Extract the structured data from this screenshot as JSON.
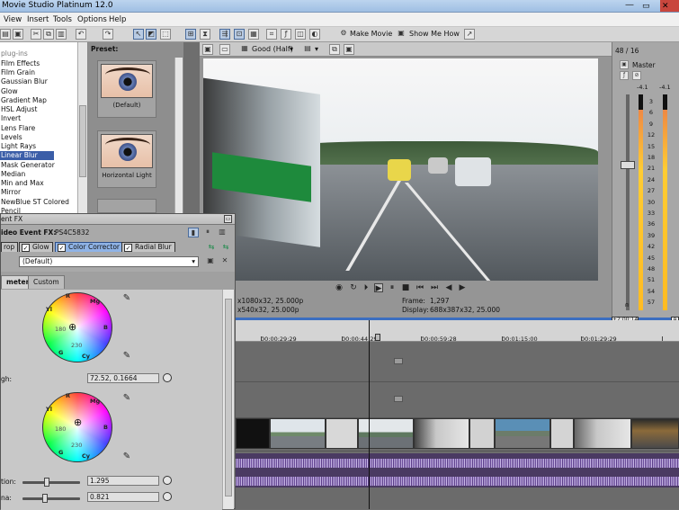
{
  "window": {
    "title": "Movie Studio Platinum 12.0",
    "minimize_glyph": "—"
  },
  "menu": {
    "items": [
      "View",
      "Insert",
      "Tools",
      "Options",
      "Help"
    ]
  },
  "toolbar": {
    "make_movie": "Make Movie",
    "show_me_how": "Show Me How"
  },
  "fx_browser": {
    "truncated_item": "plug-ins",
    "items": [
      "Film Effects",
      "Film Grain",
      "Gaussian Blur",
      "Glow",
      "Gradient Map",
      "HSL Adjust",
      "Invert",
      "Lens Flare",
      "Levels",
      "Light Rays",
      "Linear Blur",
      "Mask Generator",
      "Median",
      "Min and Max",
      "Mirror",
      "NewBlue ST Colored Pencil"
    ],
    "selected": "Linear Blur",
    "preset_label": "Preset:",
    "presets": [
      "(Default)",
      "Horizontal Light"
    ]
  },
  "preview": {
    "quality": "Good (Half)",
    "project": "x1080x32, 25.000p",
    "preview": "x540x32, 25.000p",
    "frame_label": "Frame:",
    "frame_value": "1,297",
    "display_label": "Display:",
    "display_value": "688x387x32, 25.000"
  },
  "mixer": {
    "rate": "48 / 16",
    "master": "Master",
    "peak_left": "-4.1",
    "peak_right": "-4.1",
    "scale": [
      "3",
      "6",
      "9",
      "12",
      "15",
      "18",
      "21",
      "24",
      "27",
      "30",
      "33",
      "36",
      "39",
      "42",
      "45",
      "48",
      "51",
      "54",
      "57"
    ],
    "levels": [
      0.93,
      0.93
    ]
  },
  "timeline": {
    "ruler": [
      "00:00:29:29",
      "00:00:44:29",
      "00:00:59:28",
      "00:01:15:00",
      "00:01:29:29"
    ],
    "cursor_time": "+2:00:14",
    "marker": "P"
  },
  "event_fx": {
    "window_title": "ent FX",
    "heading": "ideo Event FX:",
    "media": "PS4C5832",
    "chain": [
      {
        "label": "rop",
        "on": false
      },
      {
        "label": "Glow",
        "on": false
      },
      {
        "label": "Color Corrector",
        "on": true
      },
      {
        "label": "Radial Blur",
        "on": false
      }
    ],
    "preset": "(Default)",
    "tabs": [
      "meters",
      "Custom"
    ],
    "wheel_labels": [
      "R",
      "Mg",
      "B",
      "Cy",
      "G",
      "Yl",
      "180",
      "230"
    ],
    "high_label": "gh:",
    "high_value": "72.52, 0.1664",
    "saturation_label": "tion:",
    "saturation_value": "1.295",
    "gamma_label": "na:",
    "gamma_value": "0.821"
  }
}
